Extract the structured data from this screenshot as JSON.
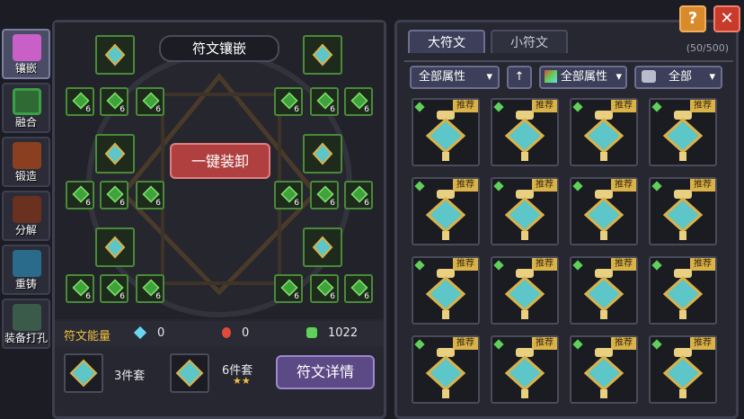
{
  "nav": {
    "items": [
      {
        "label": "镶嵌",
        "color": "#c860c8"
      },
      {
        "label": "融合",
        "color": "#3aa046"
      },
      {
        "label": "锻造",
        "color": "#c8642a"
      },
      {
        "label": "分解",
        "color": "#c85030"
      },
      {
        "label": "重铸",
        "color": "#3c8cb4"
      },
      {
        "label": "装备打孔",
        "color": "#5a7a6a"
      }
    ]
  },
  "left": {
    "title": "符文镶嵌",
    "one_click_button": "一键装卸",
    "slot_numbers": [
      "6",
      "6",
      "6",
      "6",
      "6",
      "6",
      "6",
      "6",
      "6",
      "6",
      "6",
      "6",
      "6",
      "6",
      "6",
      "6",
      "6",
      "6"
    ],
    "energy_label": "符文能量",
    "energy": {
      "blue": "0",
      "red": "0",
      "green": "1022"
    },
    "set3_label": "3件套",
    "set6_label": "6件套",
    "stars": "★★",
    "details_button": "符文详情"
  },
  "right": {
    "tab_big": "大符文",
    "tab_small": "小符文",
    "count": "(50/500)",
    "filter_attr": "全部属性",
    "filter_attr2": "全部属性",
    "filter_all": "全部",
    "badge": "推荐"
  },
  "top": {
    "help": "?",
    "close": "✕"
  },
  "colors": {
    "accent_green": "#5fd05a",
    "badge_gold": "#d9b24a",
    "red_btn": "#b04040",
    "purple_btn": "#5c4a86"
  }
}
